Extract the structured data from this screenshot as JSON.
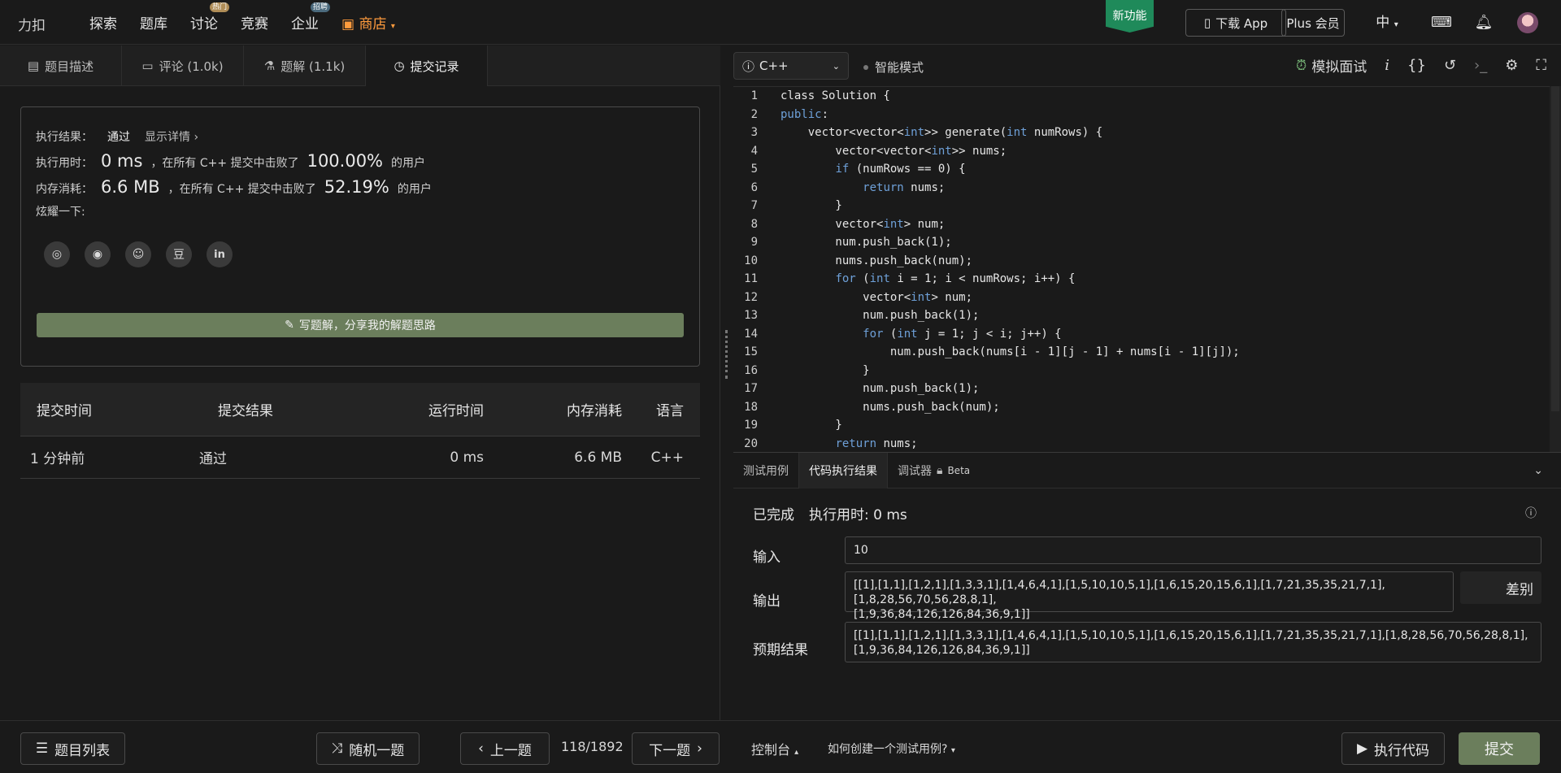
{
  "topbar": {
    "logo": "力扣",
    "nav": [
      {
        "label": "探索",
        "badge": ""
      },
      {
        "label": "题库",
        "badge": ""
      },
      {
        "label": "讨论",
        "badge": "热门"
      },
      {
        "label": "竞赛",
        "badge": ""
      },
      {
        "label": "企业",
        "badge": "招聘"
      }
    ],
    "store": "商店",
    "new_feature": "新功能",
    "download_app": "下载 App",
    "plus": "Plus 会员",
    "lang": "中"
  },
  "left_tabs": [
    {
      "label": "题目描述",
      "icon": "document-icon"
    },
    {
      "label": "评论 (1.0k)",
      "icon": "comment-icon"
    },
    {
      "label": "题解 (1.1k)",
      "icon": "flask-icon"
    },
    {
      "label": "提交记录",
      "icon": "clock-icon",
      "active": true
    }
  ],
  "result": {
    "result_label": "执行结果：",
    "result_value": "通过",
    "show_details": "显示详情 ›",
    "time_label": "执行用时：",
    "time_value": "0 ms",
    "time_mid": "，在所有 C++ 提交中击败了",
    "time_pct": "100.00%",
    "users": "的用户",
    "mem_label": "内存消耗：",
    "mem_value": "6.6 MB",
    "mem_mid": "，在所有 C++ 提交中击败了",
    "mem_pct": "52.19%",
    "share_label": "炫耀一下:",
    "write_solution": "写题解，分享我的解题思路"
  },
  "submissions": {
    "headers": [
      "提交时间",
      "提交结果",
      "运行时间",
      "内存消耗",
      "语言"
    ],
    "rows": [
      [
        "1 分钟前",
        "通过",
        "0 ms",
        "6.6 MB",
        "C++"
      ]
    ]
  },
  "editor": {
    "language": "C++",
    "smart_mode": "智能模式",
    "mock_interview": "模拟面试",
    "lines": [
      "class Solution {",
      "public:",
      "    vector<vector<int>> generate(int numRows) {",
      "        vector<vector<int>> nums;",
      "        if (numRows == 0) {",
      "            return nums;",
      "        }",
      "        vector<int> num;",
      "        num.push_back(1);",
      "        nums.push_back(num);",
      "        for (int i = 1; i < numRows; i++) {",
      "            vector<int> num;",
      "            num.push_back(1);",
      "            for (int j = 1; j < i; j++) {",
      "                num.push_back(nums[i - 1][j - 1] + nums[i - 1][j]);",
      "            }",
      "            num.push_back(1);",
      "            nums.push_back(num);",
      "        }",
      "        return nums;"
    ]
  },
  "console": {
    "tabs": [
      "测试用例",
      "代码执行结果",
      "调试器"
    ],
    "beta": "Beta",
    "status": "已完成",
    "exec_time": "执行用时: 0 ms",
    "input_label": "输入",
    "input_value": "10",
    "output_label": "输出",
    "output_value": "[[1],[1,1],[1,2,1],[1,3,3,1],[1,4,6,4,1],[1,5,10,10,5,1],[1,6,15,20,15,6,1],[1,7,21,35,35,21,7,1],[1,8,28,56,70,56,28,8,1],\n[1,9,36,84,126,126,84,36,9,1]]",
    "diff": "差别",
    "expected_label": "预期结果",
    "expected_value": "[[1],[1,1],[1,2,1],[1,3,3,1],[1,4,6,4,1],[1,5,10,10,5,1],[1,6,15,20,15,6,1],[1,7,21,35,35,21,7,1],[1,8,28,56,70,56,28,8,1],\n[1,9,36,84,126,126,84,36,9,1]]"
  },
  "bottom": {
    "problem_list": "题目列表",
    "random": "随机一题",
    "prev": "上一题",
    "page": "118/1892",
    "next": "下一题",
    "console": "控制台",
    "how_to": "如何创建一个测试用例?",
    "run": "执行代码",
    "submit": "提交"
  }
}
